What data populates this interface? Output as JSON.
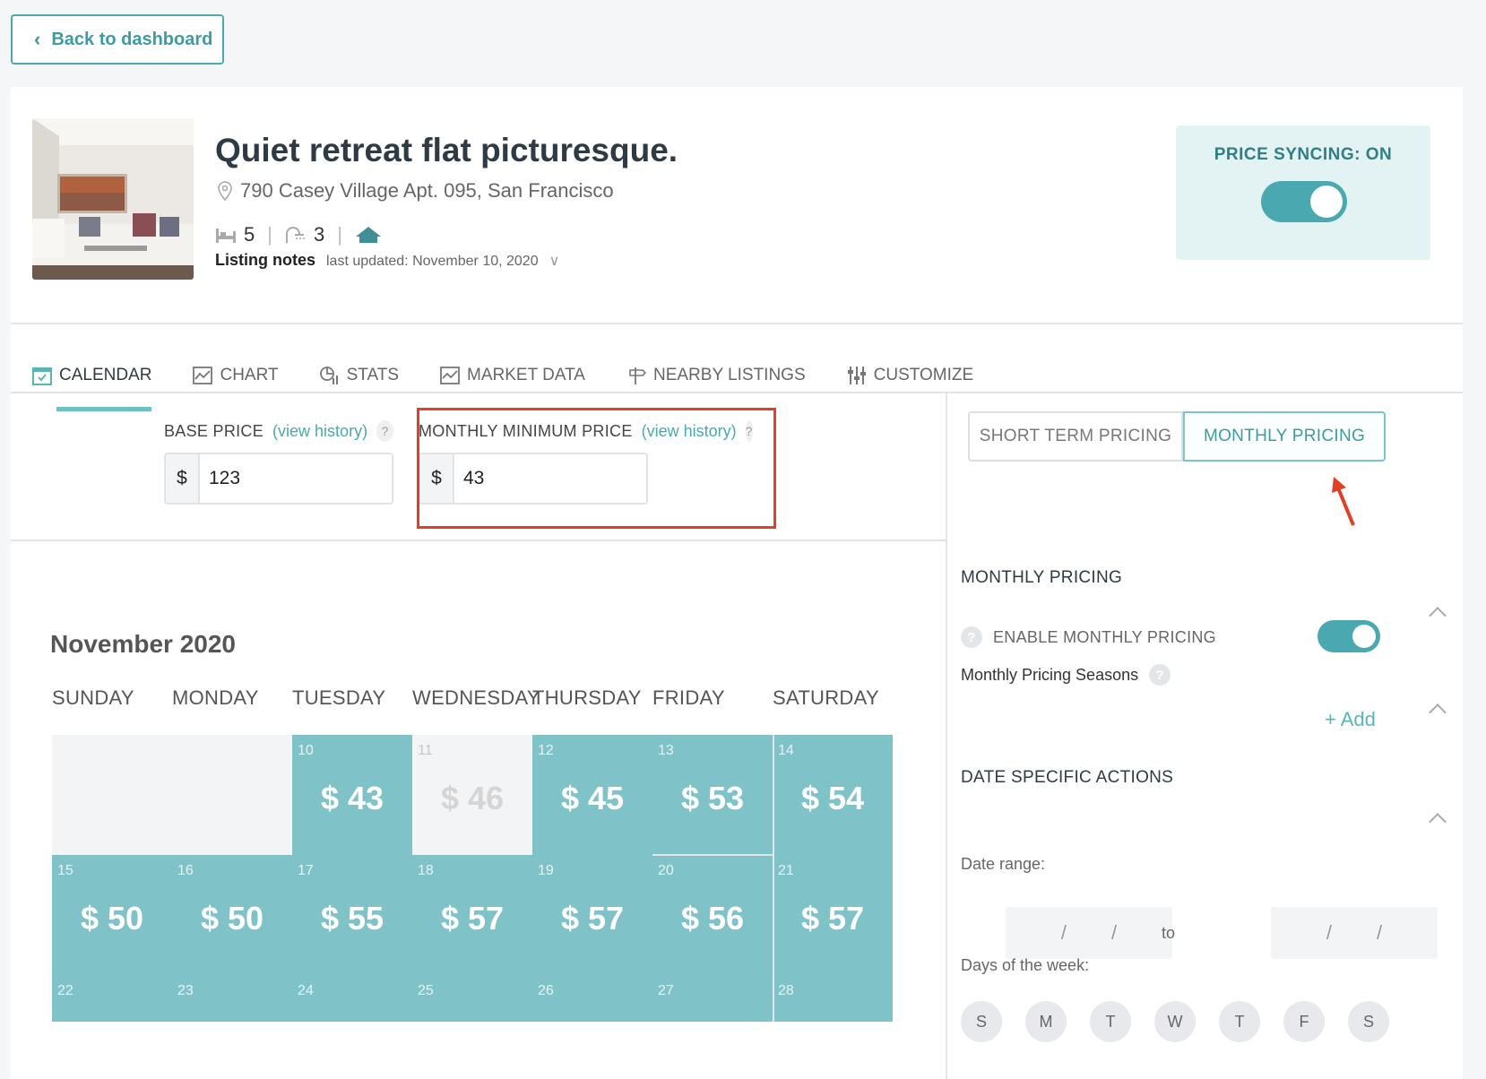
{
  "nav": {
    "back_label": "Back to dashboard"
  },
  "listing": {
    "title": "Quiet retreat flat picturesque.",
    "address": "790 Casey Village Apt. 095, San Francisco",
    "bedrooms": "5",
    "bathrooms": "3",
    "notes_label": "Listing notes",
    "last_updated": "last updated: November 10, 2020"
  },
  "sync": {
    "label": "PRICE SYNCING: ON",
    "enabled": true
  },
  "tabs": [
    {
      "label": "CALENDAR",
      "icon": "calendar-icon",
      "active": true
    },
    {
      "label": "CHART",
      "icon": "chart-icon",
      "active": false
    },
    {
      "label": "STATS",
      "icon": "stats-icon",
      "active": false
    },
    {
      "label": "MARKET DATA",
      "icon": "market-data-icon",
      "active": false
    },
    {
      "label": "NEARBY LISTINGS",
      "icon": "signpost-icon",
      "active": false
    },
    {
      "label": "CUSTOMIZE",
      "icon": "sliders-icon",
      "active": false
    }
  ],
  "prices": {
    "base": {
      "label": "BASE PRICE",
      "link": "(view history)",
      "help": "?",
      "currency": "$",
      "value": "123"
    },
    "monthly_min": {
      "label": "MONTHLY MINIMUM PRICE",
      "link": "(view history)",
      "help": "?",
      "currency": "$",
      "value": "43"
    }
  },
  "pricing_mode": {
    "short_term": "SHORT TERM PRICING",
    "monthly": "MONTHLY PRICING",
    "selected": "monthly"
  },
  "calendar": {
    "month": "November 2020",
    "weekdays": [
      "SUNDAY",
      "MONDAY",
      "TUESDAY",
      "WEDNESDAY",
      "THURSDAY",
      "FRIDAY",
      "SATURDAY"
    ],
    "weeks": [
      [
        {
          "day": "",
          "price": "",
          "state": "empty"
        },
        {
          "day": "",
          "price": "",
          "state": "empty"
        },
        {
          "day": "10",
          "price": "$ 43",
          "state": "active"
        },
        {
          "day": "11",
          "price": "$ 46",
          "state": "past"
        },
        {
          "day": "12",
          "price": "$ 45",
          "state": "active"
        },
        {
          "day": "13",
          "price": "$ 53",
          "state": "active"
        },
        {
          "day": "14",
          "price": "$ 54",
          "state": "active"
        }
      ],
      [
        {
          "day": "15",
          "price": "$ 50",
          "state": "active"
        },
        {
          "day": "16",
          "price": "$ 50",
          "state": "active"
        },
        {
          "day": "17",
          "price": "$ 55",
          "state": "active"
        },
        {
          "day": "18",
          "price": "$ 57",
          "state": "active"
        },
        {
          "day": "19",
          "price": "$ 57",
          "state": "active"
        },
        {
          "day": "20",
          "price": "$ 56",
          "state": "active"
        },
        {
          "day": "21",
          "price": "$ 57",
          "state": "active"
        }
      ],
      [
        {
          "day": "22",
          "price": "",
          "state": "active"
        },
        {
          "day": "23",
          "price": "",
          "state": "active"
        },
        {
          "day": "24",
          "price": "",
          "state": "active"
        },
        {
          "day": "25",
          "price": "",
          "state": "active"
        },
        {
          "day": "26",
          "price": "",
          "state": "active"
        },
        {
          "day": "27",
          "price": "",
          "state": "active"
        },
        {
          "day": "28",
          "price": "",
          "state": "active"
        }
      ]
    ]
  },
  "side_panel": {
    "monthly_pricing_title": "MONTHLY PRICING",
    "enable_label": "ENABLE MONTHLY PRICING",
    "enable_on": true,
    "seasons_label": "Monthly Pricing Seasons",
    "add_label": "+ Add",
    "date_actions_title": "DATE SPECIFIC ACTIONS",
    "date_range_label": "Date range:",
    "date_from": "/ /",
    "to_label": "to",
    "date_to": "/ /",
    "days_label": "Days of the week:",
    "days": [
      "S",
      "M",
      "T",
      "W",
      "T",
      "F",
      "S"
    ]
  },
  "colors": {
    "accent": "#4aa9b0",
    "calendar_cell": "#7fc3c9",
    "highlight_box": "#e24026"
  }
}
